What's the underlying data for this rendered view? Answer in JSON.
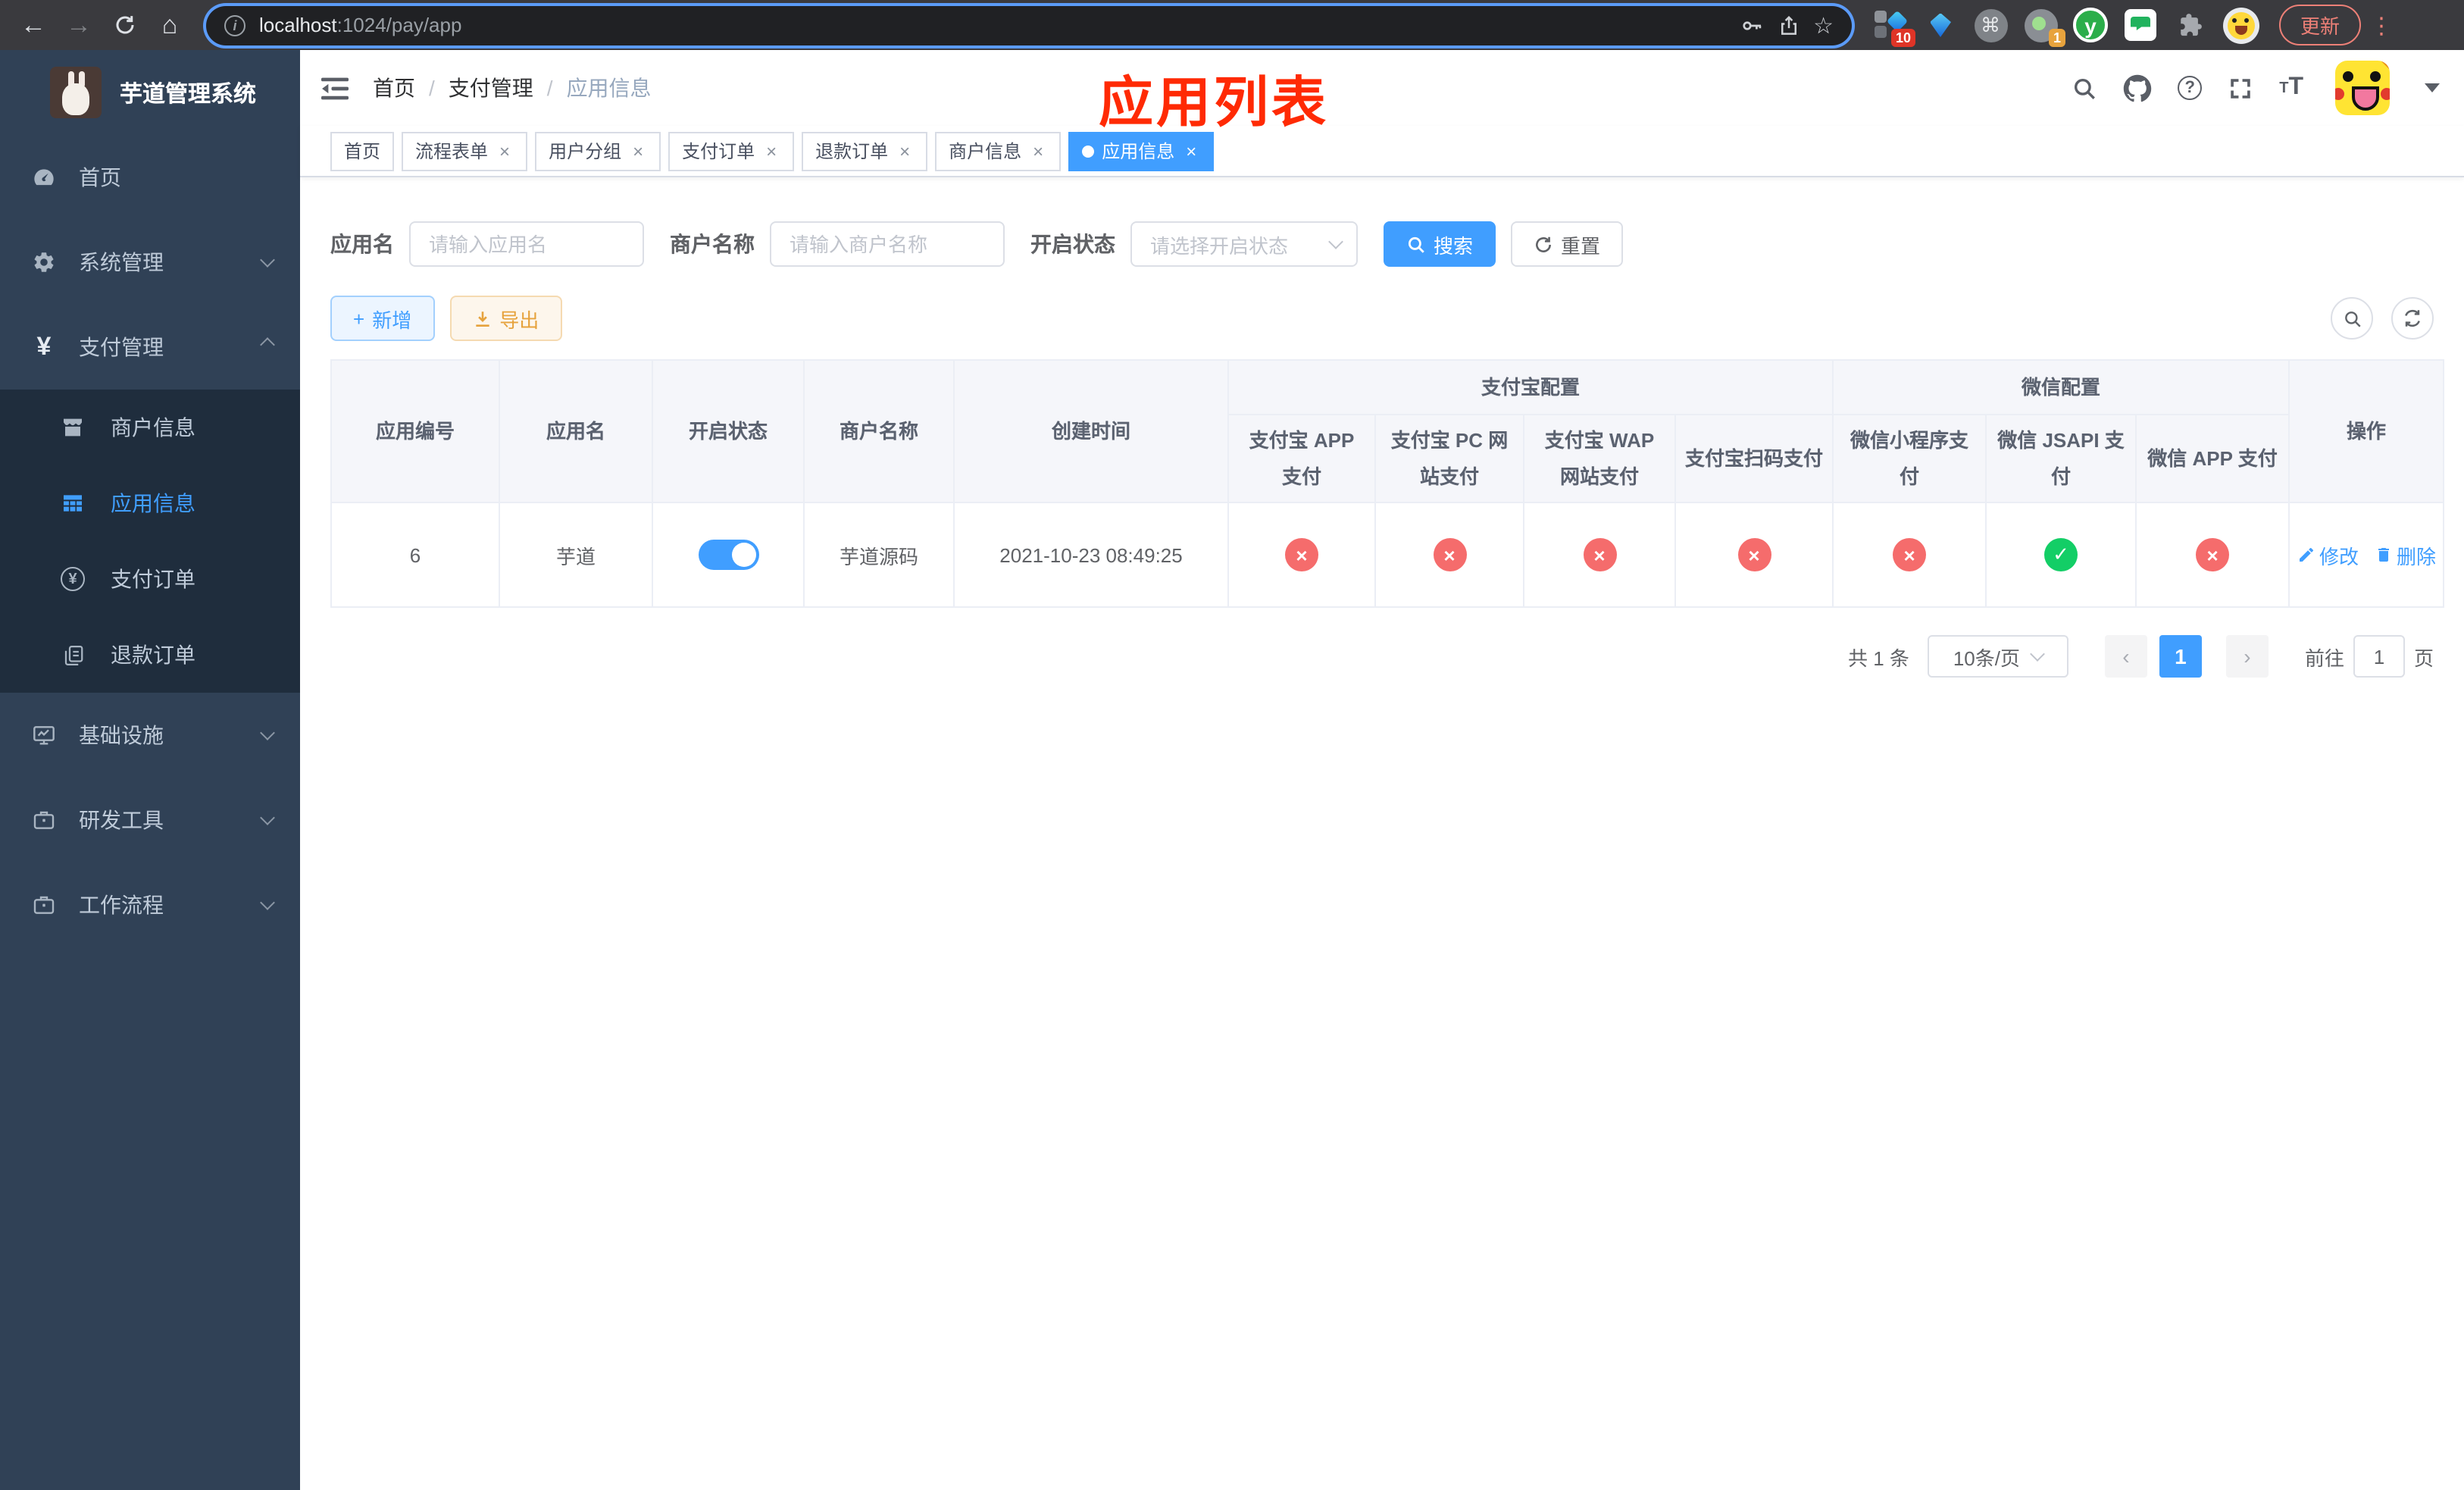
{
  "browser": {
    "url": {
      "host": "localhost",
      "path": ":1024/pay/app"
    },
    "update_label": "更新",
    "ext_badge_1": "10",
    "ext_badge_2": "1"
  },
  "icons": {
    "back": "←",
    "forward": "→",
    "home": "⌂",
    "star": "☆",
    "kebab": "⋮",
    "info": "i",
    "command": "⌘",
    "ext_y": "y",
    "help": "?",
    "text_small": "T",
    "text_large": "T",
    "yen": "¥",
    "close": "×",
    "plus": "+",
    "prev": "‹",
    "next": "›"
  },
  "sidebar": {
    "title": "芋道管理系统",
    "menu": [
      {
        "label": "首页",
        "icon": "dashboard-icon"
      },
      {
        "label": "系统管理",
        "icon": "gear-icon"
      },
      {
        "label": "支付管理",
        "icon": "yen-icon",
        "children": [
          {
            "label": "商户信息",
            "icon": "store-icon"
          },
          {
            "label": "应用信息",
            "icon": "grid-icon",
            "active": true
          },
          {
            "label": "支付订单",
            "icon": "yen-circle-icon"
          },
          {
            "label": "退款订单",
            "icon": "document-icon"
          }
        ]
      },
      {
        "label": "基础设施",
        "icon": "monitor-icon"
      },
      {
        "label": "研发工具",
        "icon": "briefcase-icon"
      },
      {
        "label": "工作流程",
        "icon": "briefcase-icon"
      }
    ]
  },
  "navbar": {
    "breadcrumb": [
      "首页",
      "支付管理",
      "应用信息"
    ],
    "annotation": "应用列表"
  },
  "tags": [
    {
      "label": "首页"
    },
    {
      "label": "流程表单"
    },
    {
      "label": "用户分组"
    },
    {
      "label": "支付订单"
    },
    {
      "label": "退款订单"
    },
    {
      "label": "商户信息"
    },
    {
      "label": "应用信息",
      "active": true
    }
  ],
  "filters": {
    "app_name": {
      "label": "应用名",
      "placeholder": "请输入应用名"
    },
    "merchant": {
      "label": "商户名称",
      "placeholder": "请输入商户名称"
    },
    "status": {
      "label": "开启状态",
      "placeholder": "请选择开启状态"
    },
    "search_label": "搜索",
    "reset_label": "重置"
  },
  "toolbar": {
    "add_label": "新增",
    "export_label": "导出"
  },
  "table": {
    "col_id": "应用编号",
    "col_name": "应用名",
    "col_status": "开启状态",
    "col_merchant": "商户名称",
    "col_created": "创建时间",
    "group_alipay": "支付宝配置",
    "group_wechat": "微信配置",
    "alipay_cols": [
      "支付宝 APP 支付",
      "支付宝 PC 网站支付",
      "支付宝 WAP 网站支付",
      "支付宝扫码支付"
    ],
    "wechat_cols": [
      "微信小程序支付",
      "微信 JSAPI 支付",
      "微信 APP 支付"
    ],
    "col_ops": "操作",
    "row": {
      "id": "6",
      "name": "芋道",
      "enabled": true,
      "merchant": "芋道源码",
      "created_at": "2021-10-23 08:49:25",
      "statuses": [
        "fail",
        "fail",
        "fail",
        "fail",
        "fail",
        "success",
        "fail"
      ],
      "edit_label": "修改",
      "delete_label": "删除"
    }
  },
  "pagination": {
    "total": "共 1 条",
    "size": "10条/页",
    "page": "1",
    "goto_label": "前往",
    "goto_value": "1",
    "unit_label": "页"
  },
  "colors": {
    "accent": "#409eff",
    "danger": "#f56c6c",
    "success": "#13ce66",
    "warning": "#e6a23c",
    "sidebar_bg": "#304156",
    "submenu_bg": "#1f2d3d",
    "annotation": "#ff2a04"
  }
}
